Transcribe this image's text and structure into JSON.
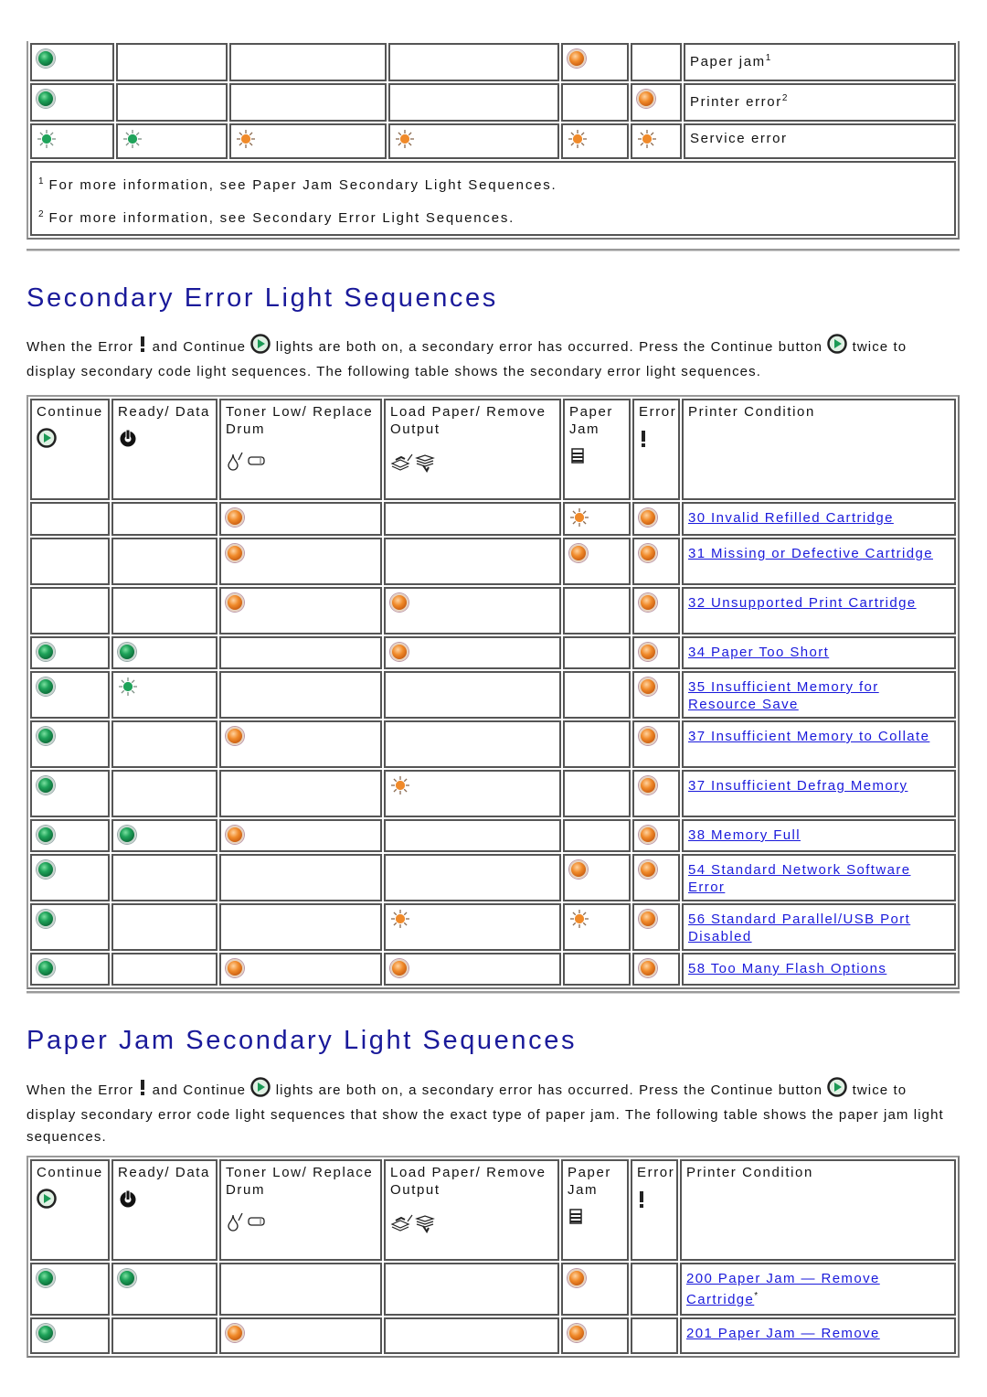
{
  "colors": {
    "heading": "#1a1a9a",
    "link": "#1a1adb",
    "led_green": "#1fa35a",
    "led_orange": "#f08a2a"
  },
  "top_table": {
    "rows": [
      {
        "lights": [
          "on-green",
          "",
          "",
          "",
          "on-orange",
          ""
        ],
        "condition": "Paper jam",
        "sup": "1"
      },
      {
        "lights": [
          "on-green",
          "",
          "",
          "",
          "",
          "on-orange"
        ],
        "condition": "Printer error",
        "sup": "2"
      },
      {
        "lights": [
          "blink-green",
          "blink-green",
          "blink-orange",
          "blink-orange",
          "blink-orange",
          "blink-orange"
        ],
        "condition": "Service error",
        "sup": ""
      }
    ],
    "footnotes": [
      {
        "mark": "1",
        "text": "For more information, see Paper Jam Secondary Light Sequences."
      },
      {
        "mark": "2",
        "text": "For more information, see Secondary Error Light Sequences."
      }
    ]
  },
  "secondary": {
    "title": "Secondary Error Light Sequences",
    "intro": {
      "part1": "When the Error",
      "part2": "and Continue",
      "part3": "lights are both on, a secondary error has occurred. Press the Continue button",
      "part4": "twice to display secondary code light sequences. The following table shows the secondary error light sequences."
    },
    "headers": [
      "Continue",
      "Ready/ Data",
      "Toner Low/ Replace Drum",
      "Load Paper/ Remove Output",
      "Paper Jam",
      "Error",
      "Printer Condition"
    ],
    "header_icons": [
      "continue-icon",
      "power-icon",
      "toner-drum-icons",
      "load-paper-icons",
      "paper-jam-icon",
      "error-icon",
      ""
    ],
    "rows": [
      {
        "lights": [
          "",
          "",
          "on-orange",
          "",
          "blink-orange",
          "on-orange"
        ],
        "condition": "30 Invalid Refilled Cartridge"
      },
      {
        "lights": [
          "",
          "",
          "on-orange",
          "",
          "on-orange",
          "on-orange"
        ],
        "condition": "31 Missing or Defective Cartridge"
      },
      {
        "lights": [
          "",
          "",
          "on-orange",
          "on-orange",
          "",
          "on-orange"
        ],
        "condition": "32 Unsupported Print Cartridge"
      },
      {
        "lights": [
          "on-green",
          "on-green",
          "",
          "on-orange",
          "",
          "on-orange"
        ],
        "condition": "34 Paper Too Short"
      },
      {
        "lights": [
          "on-green",
          "blink-green",
          "",
          "",
          "",
          "on-orange"
        ],
        "condition": "35 Insufficient Memory for Resource Save"
      },
      {
        "lights": [
          "on-green",
          "",
          "on-orange",
          "",
          "",
          "on-orange"
        ],
        "condition": "37 Insufficient Memory to Collate"
      },
      {
        "lights": [
          "on-green",
          "",
          "",
          "blink-orange",
          "",
          "on-orange"
        ],
        "condition": "37 Insufficient Defrag Memory"
      },
      {
        "lights": [
          "on-green",
          "on-green",
          "on-orange",
          "",
          "",
          "on-orange"
        ],
        "condition": "38 Memory Full"
      },
      {
        "lights": [
          "on-green",
          "",
          "",
          "",
          "on-orange",
          "on-orange"
        ],
        "condition": "54 Standard Network Software Error"
      },
      {
        "lights": [
          "on-green",
          "",
          "",
          "blink-orange",
          "blink-orange",
          "on-orange"
        ],
        "condition": "56 Standard Parallel/USB Port Disabled"
      },
      {
        "lights": [
          "on-green",
          "",
          "on-orange",
          "on-orange",
          "",
          "on-orange"
        ],
        "condition": "58 Too Many Flash Options"
      }
    ]
  },
  "paperjam": {
    "title": "Paper Jam Secondary Light Sequences",
    "intro": {
      "part1": "When the Error",
      "part2": "and Continue",
      "part3": "lights are both on, a secondary error has occurred. Press the Continue button",
      "part4": "twice to display secondary error code light sequences that show the exact type of paper jam. The following table shows the paper jam light sequences."
    },
    "headers": [
      "Continue",
      "Ready/ Data",
      "Toner Low/ Replace Drum",
      "Load Paper/ Remove Output",
      "Paper Jam",
      "Error",
      "Printer Condition"
    ],
    "rows": [
      {
        "lights": [
          "on-green",
          "on-green",
          "",
          "",
          "on-orange",
          ""
        ],
        "condition": "200 Paper Jam — Remove Cartridge",
        "sup": "*"
      },
      {
        "lights": [
          "on-green",
          "",
          "on-orange",
          "",
          "on-orange",
          ""
        ],
        "condition": "201 Paper Jam — Remove",
        "sup": ""
      }
    ]
  }
}
